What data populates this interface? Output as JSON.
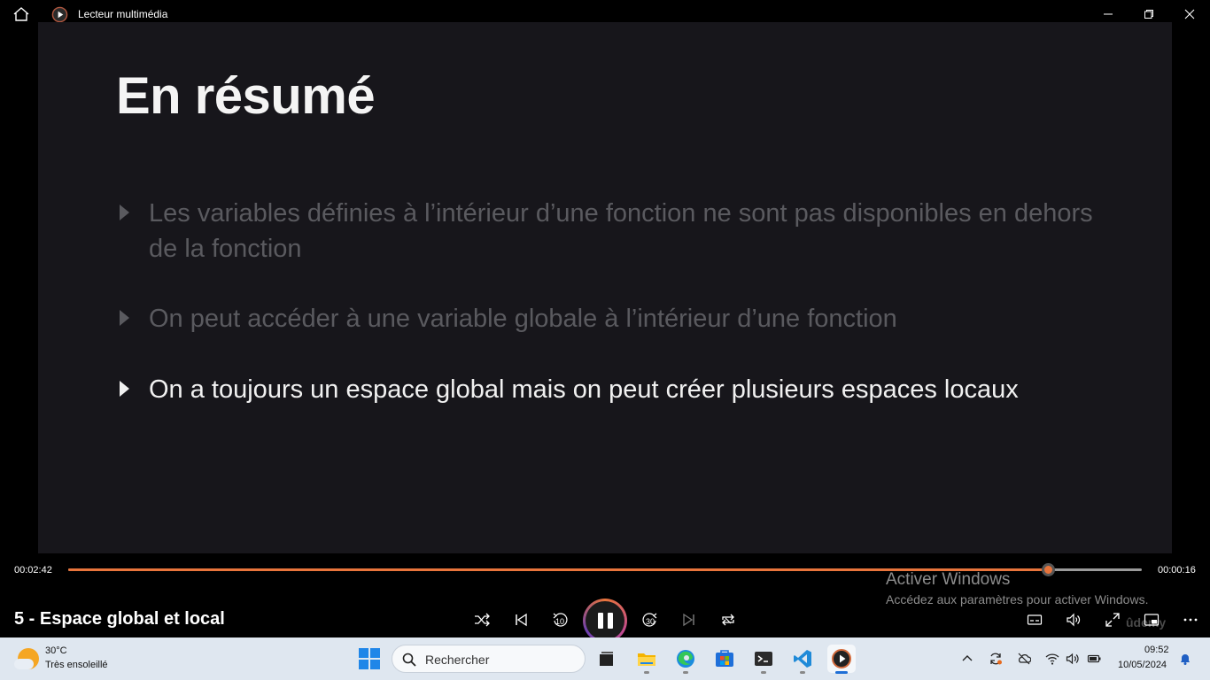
{
  "window": {
    "title": "Lecteur multimédia",
    "icons": [
      "home-icon",
      "media-player-icon",
      "minimize-icon",
      "restore-icon",
      "close-icon"
    ]
  },
  "slide": {
    "title": "En résumé",
    "bullets": [
      {
        "text": "Les variables définies à l’intérieur d’une fonction ne sont pas disponibles en dehors de la fonction",
        "state": "dimmed"
      },
      {
        "text": "On peut accéder à une variable globale à l’intérieur d’une fonction",
        "state": "dimmed"
      },
      {
        "text": "On a toujours un espace global mais on peut créer plusieurs espaces locaux",
        "state": "highlighted"
      }
    ]
  },
  "player": {
    "elapsed": "00:02:42",
    "remaining": "00:00:16",
    "progress": 0.9125,
    "media_title": "5 - Espace global et local",
    "skip_back_seconds": "10",
    "skip_forward_seconds": "30",
    "state": "playing",
    "accent_color": "#e8743b",
    "controls": [
      "shuffle-icon",
      "previous-icon",
      "skip-back-icon",
      "pause-icon",
      "skip-forward-icon",
      "next-icon",
      "repeat-icon",
      "subtitles-icon",
      "volume-icon",
      "fullscreen-icon",
      "miniplayer-icon",
      "more-options-icon"
    ]
  },
  "activation_watermark": {
    "title": "Activer Windows",
    "subtitle": "Accédez aux paramètres pour activer Windows."
  },
  "video_watermark": "ûdemy",
  "taskbar": {
    "weather": {
      "temperature": "30°C",
      "condition": "Très ensoleillé"
    },
    "search_placeholder": "Rechercher",
    "apps": [
      "task-view-icon",
      "file-explorer-icon",
      "edge-icon",
      "store-icon",
      "terminal-icon",
      "vscode-icon",
      "media-player-icon"
    ],
    "tray": [
      "chevron-up-icon",
      "sync-icon",
      "onedrive-offline-icon",
      "wifi-icon",
      "volume-icon",
      "battery-icon"
    ],
    "clock": {
      "time": "09:52",
      "date": "10/05/2024"
    },
    "notification_icon": "bell-icon"
  }
}
